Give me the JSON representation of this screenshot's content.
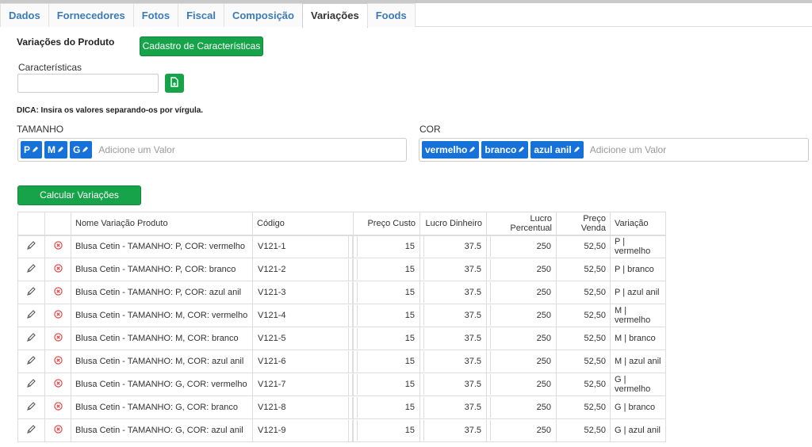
{
  "tabs": [
    "Dados",
    "Fornecedores",
    "Fotos",
    "Fiscal",
    "Composição",
    "Variações",
    "Foods"
  ],
  "active_tab": "Variações",
  "section_title": "Variações do Produto",
  "cadastro_button": "Cadastro de Características",
  "caracteristicas_label": "Características",
  "caracteristicas_value": "",
  "add_icon": "file-add-icon",
  "dica": "DICA: Insira os valores separando-os por vírgula.",
  "tamanho": {
    "label": "TAMANHO",
    "tags": [
      "P",
      "M",
      "G"
    ],
    "placeholder": "Adicione um Valor"
  },
  "cor": {
    "label": "COR",
    "tags": [
      "vermelho",
      "branco",
      "azul anil"
    ],
    "placeholder": "Adicione um Valor"
  },
  "calcular_button": "Calcular Variações",
  "table": {
    "headers": [
      "",
      "",
      "Nome Variação Produto",
      "Código",
      "Preço Custo",
      "Lucro Dinheiro",
      "Lucro Percentual",
      "Preço Venda",
      "Variação"
    ],
    "rows": [
      [
        "Blusa Cetin - TAMANHO: P, COR: vermelho",
        "V121-1",
        "15",
        "37.5",
        "250",
        "52,50",
        "P | vermelho"
      ],
      [
        "Blusa Cetin - TAMANHO: P, COR: branco",
        "V121-2",
        "15",
        "37.5",
        "250",
        "52,50",
        "P | branco"
      ],
      [
        "Blusa Cetin - TAMANHO: P, COR: azul anil",
        "V121-3",
        "15",
        "37.5",
        "250",
        "52,50",
        "P | azul anil"
      ],
      [
        "Blusa Cetin - TAMANHO: M, COR: vermelho",
        "V121-4",
        "15",
        "37.5",
        "250",
        "52,50",
        "M | vermelho"
      ],
      [
        "Blusa Cetin - TAMANHO: M, COR: branco",
        "V121-5",
        "15",
        "37.5",
        "250",
        "52,50",
        "M | branco"
      ],
      [
        "Blusa Cetin - TAMANHO: M, COR: azul anil",
        "V121-6",
        "15",
        "37.5",
        "250",
        "52,50",
        "M | azul anil"
      ],
      [
        "Blusa Cetin - TAMANHO: G, COR: vermelho",
        "V121-7",
        "15",
        "37.5",
        "250",
        "52,50",
        "G | vermelho"
      ],
      [
        "Blusa Cetin - TAMANHO: G, COR: branco",
        "V121-8",
        "15",
        "37.5",
        "250",
        "52,50",
        "G | branco"
      ],
      [
        "Blusa Cetin - TAMANHO: G, COR: azul anil",
        "V121-9",
        "15",
        "37.5",
        "250",
        "52,50",
        "G | azul anil"
      ]
    ]
  },
  "colors": {
    "tab_link": "#3a7bb8",
    "green": "#17a34a",
    "tag_blue": "#1672d9",
    "delete_red": "#e03a3a"
  },
  "icons": {
    "edit": "pencil-icon",
    "delete": "remove-circle-icon",
    "tag_edit": "pencil-icon"
  }
}
